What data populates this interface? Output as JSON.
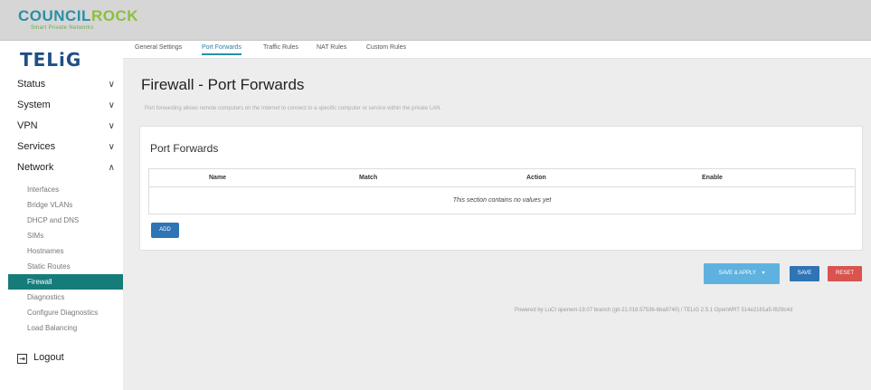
{
  "header": {
    "brand_part1": "COUNCIL",
    "brand_part2": "ROCK",
    "brand_tagline": "Smart Private Networks"
  },
  "sidebar": {
    "logo": "TELiG",
    "menu": [
      {
        "label": "Status",
        "chevron": "∨"
      },
      {
        "label": "System",
        "chevron": "∨"
      },
      {
        "label": "VPN",
        "chevron": "∨"
      },
      {
        "label": "Services",
        "chevron": "∨"
      },
      {
        "label": "Network",
        "chevron": "∧"
      }
    ],
    "network_items": [
      "Interfaces",
      "Bridge VLANs",
      "DHCP and DNS",
      "SIMs",
      "Hostnames",
      "Static Routes",
      "Firewall",
      "Diagnostics",
      "Configure Diagnostics",
      "Load Balancing"
    ],
    "active_item": "Firewall",
    "logout_label": "Logout",
    "logout_icon": "logout-icon"
  },
  "tabs": [
    {
      "label": "General Settings"
    },
    {
      "label": "Port Forwards"
    },
    {
      "label": "Traffic Rules"
    },
    {
      "label": "NAT Rules"
    },
    {
      "label": "Custom Rules"
    }
  ],
  "active_tab": "Port Forwards",
  "page": {
    "title": "Firewall - Port Forwards",
    "description": "Port forwarding allows remote computers on the Internet to connect to a specific computer or service within the private LAN."
  },
  "section": {
    "title": "Port Forwards",
    "columns": [
      "Name",
      "Match",
      "Action",
      "Enable"
    ],
    "empty_message": "This section contains no values yet",
    "add_label": "ADD"
  },
  "actions": {
    "save_apply_label": "SAVE & APPLY",
    "save_apply_caret": "▾",
    "save_label": "SAVE",
    "reset_label": "RESET"
  },
  "footer": {
    "text": "Powered by LuCI openwrt-19.07 branch (git-21.018.57536-6ba9740) / TELiG 2.5.1 OpenWRT 514e2181a5-f829c4d"
  },
  "colors": {
    "accent": "#2a8fa6",
    "active_menu": "#167c79",
    "primary_button": "#2f74b5",
    "apply_button": "#5fb2e0",
    "reset_button": "#d9534f",
    "logo": "#1f4f86"
  }
}
